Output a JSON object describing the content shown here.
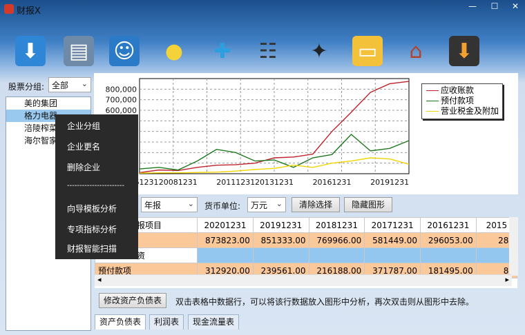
{
  "window": {
    "title": "财报X",
    "min": "—",
    "max": "☐",
    "close": "✕"
  },
  "toolbar": {
    "icons": [
      "download-icon",
      "drawer-icon",
      "contacts-icon",
      "lightbulb-icon",
      "puzzle-icon",
      "org-chart-icon",
      "magic-wand-icon",
      "folders-icon",
      "home-icon",
      "save-icon"
    ]
  },
  "left": {
    "group_label": "股票分组:",
    "group_value": "全部",
    "stocks": [
      "美的集团",
      "格力电器",
      "涪陵榨菜",
      "海尔智家"
    ]
  },
  "context_menu": {
    "items": [
      "企业分组",
      "企业更名",
      "删除企业",
      "-----------------------",
      "向导模板分析",
      "专项指标分析",
      "财报智能扫描"
    ]
  },
  "controls": {
    "period": "年报",
    "currency_label": "货币单位:",
    "currency": "万元",
    "clear": "清除选择",
    "hide": "隐藏图形"
  },
  "chart_data": {
    "type": "line",
    "x": [
      "20061231",
      "20071231",
      "20081231",
      "20091231",
      "20101231",
      "20111231",
      "20121231",
      "20131231",
      "20141231",
      "20151231",
      "20161231",
      "20171231",
      "20181231",
      "20191231",
      "20201231"
    ],
    "x_tick_labels": [
      "61231",
      "20081231",
      "20111231",
      "20131231",
      "20161231",
      "20191231"
    ],
    "yticks": [
      "800,000",
      "700,000",
      "600,000"
    ],
    "ylim": [
      0,
      900000
    ],
    "grid": true,
    "legend_position": "right",
    "series": [
      {
        "name": "应收账款",
        "color": "#c0202a",
        "values": [
          10000,
          35000,
          30000,
          60000,
          80000,
          85000,
          100000,
          150000,
          158000,
          185000,
          400000,
          581449,
          769966,
          851333,
          873823
        ]
      },
      {
        "name": "预付款项",
        "color": "#1e7a1e",
        "values": [
          45000,
          60000,
          35000,
          120000,
          230000,
          200000,
          120000,
          130000,
          60000,
          150000,
          181495,
          371787,
          216188,
          239561,
          312920
        ]
      },
      {
        "name": "营业税金及附加",
        "color": "#f5d400",
        "values": [
          5000,
          8000,
          8000,
          12000,
          15000,
          25000,
          40000,
          50000,
          80000,
          60000,
          100000,
          120000,
          150000,
          140000,
          90000
        ]
      }
    ]
  },
  "table": {
    "header": [
      "报项目",
      "20201231",
      "20191231",
      "20181231",
      "20171231",
      "20161231",
      "2015"
    ],
    "rows": [
      {
        "label": "",
        "values": [
          "873823.00",
          "851333.00",
          "769966.00",
          "581449.00",
          "296053.00",
          "287"
        ]
      },
      {
        "label": "资",
        "values": [
          "",
          "",
          "",
          "",
          "",
          ""
        ]
      },
      {
        "label": "预付款项",
        "values": [
          "312920.00",
          "239561.00",
          "216188.00",
          "371787.00",
          "181495.00",
          "84"
        ]
      }
    ]
  },
  "bottom": {
    "modify_button": "修改资产负债表",
    "hint": "双击表格中数据行，可以将该行数据放入图形中分析，再次双击则从图形中去除。"
  },
  "tabs": [
    "资产负债表",
    "利润表",
    "现金流量表"
  ]
}
